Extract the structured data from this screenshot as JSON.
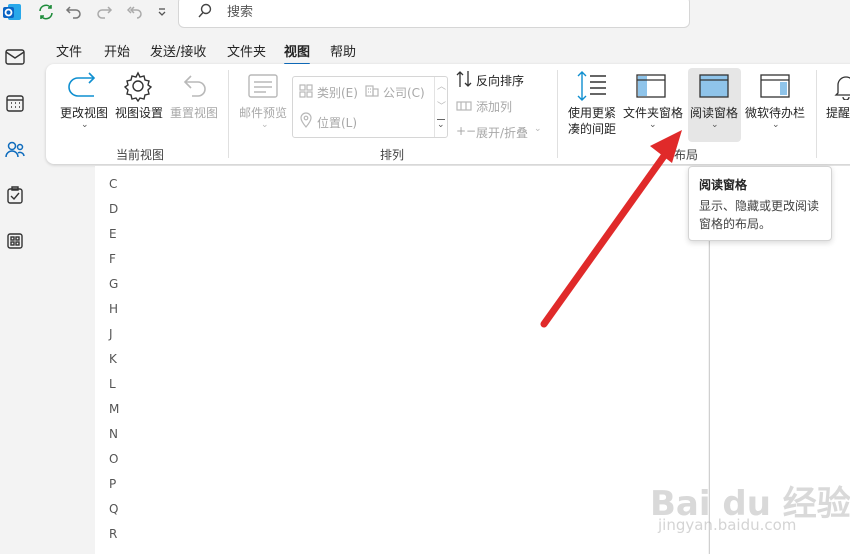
{
  "titlebar": {
    "search_placeholder": "搜索",
    "app_icon_text": "O"
  },
  "menu": {
    "items": [
      "文件",
      "开始",
      "发送/接收",
      "文件夹",
      "视图",
      "帮助"
    ],
    "active": "视图"
  },
  "ribbon": {
    "current_view": {
      "change_view": "更改视图",
      "view_settings": "视图设置",
      "reset_view": "重置视图",
      "group_label": "当前视图"
    },
    "arrangement": {
      "message_preview": "邮件预览",
      "category": "类别(E)",
      "company": "公司(C)",
      "location": "位置(L)",
      "reverse_sort": "反向排序",
      "add_columns": "添加列",
      "expand_collapse": "展开/折叠",
      "group_label": "排列"
    },
    "layout": {
      "compact": "使用更紧凑的间距",
      "compact_line1": "使用更紧",
      "compact_line2": "凑的间距",
      "folder_pane": "文件夹窗格",
      "reading_pane": "阅读窗格",
      "todo_bar": "微软待办栏",
      "group_label": "布局",
      "group_label_visible": "布局"
    },
    "reminder": "提醒"
  },
  "tooltip": {
    "title": "阅读窗格",
    "description": "显示、隐藏或更改阅读窗格的布局。"
  },
  "letters": [
    "C",
    "D",
    "E",
    "F",
    "G",
    "H",
    "J",
    "K",
    "L",
    "M",
    "N",
    "O",
    "P",
    "Q",
    "R"
  ],
  "watermark": {
    "main": "Bai du 经验",
    "sub": "jingyan.baidu.com"
  },
  "colors": {
    "accent": "#0f6cbd",
    "outlook_blue": "#0a64c4",
    "arrow_red": "#e02a2a",
    "sync_green": "#1e8b3a"
  }
}
